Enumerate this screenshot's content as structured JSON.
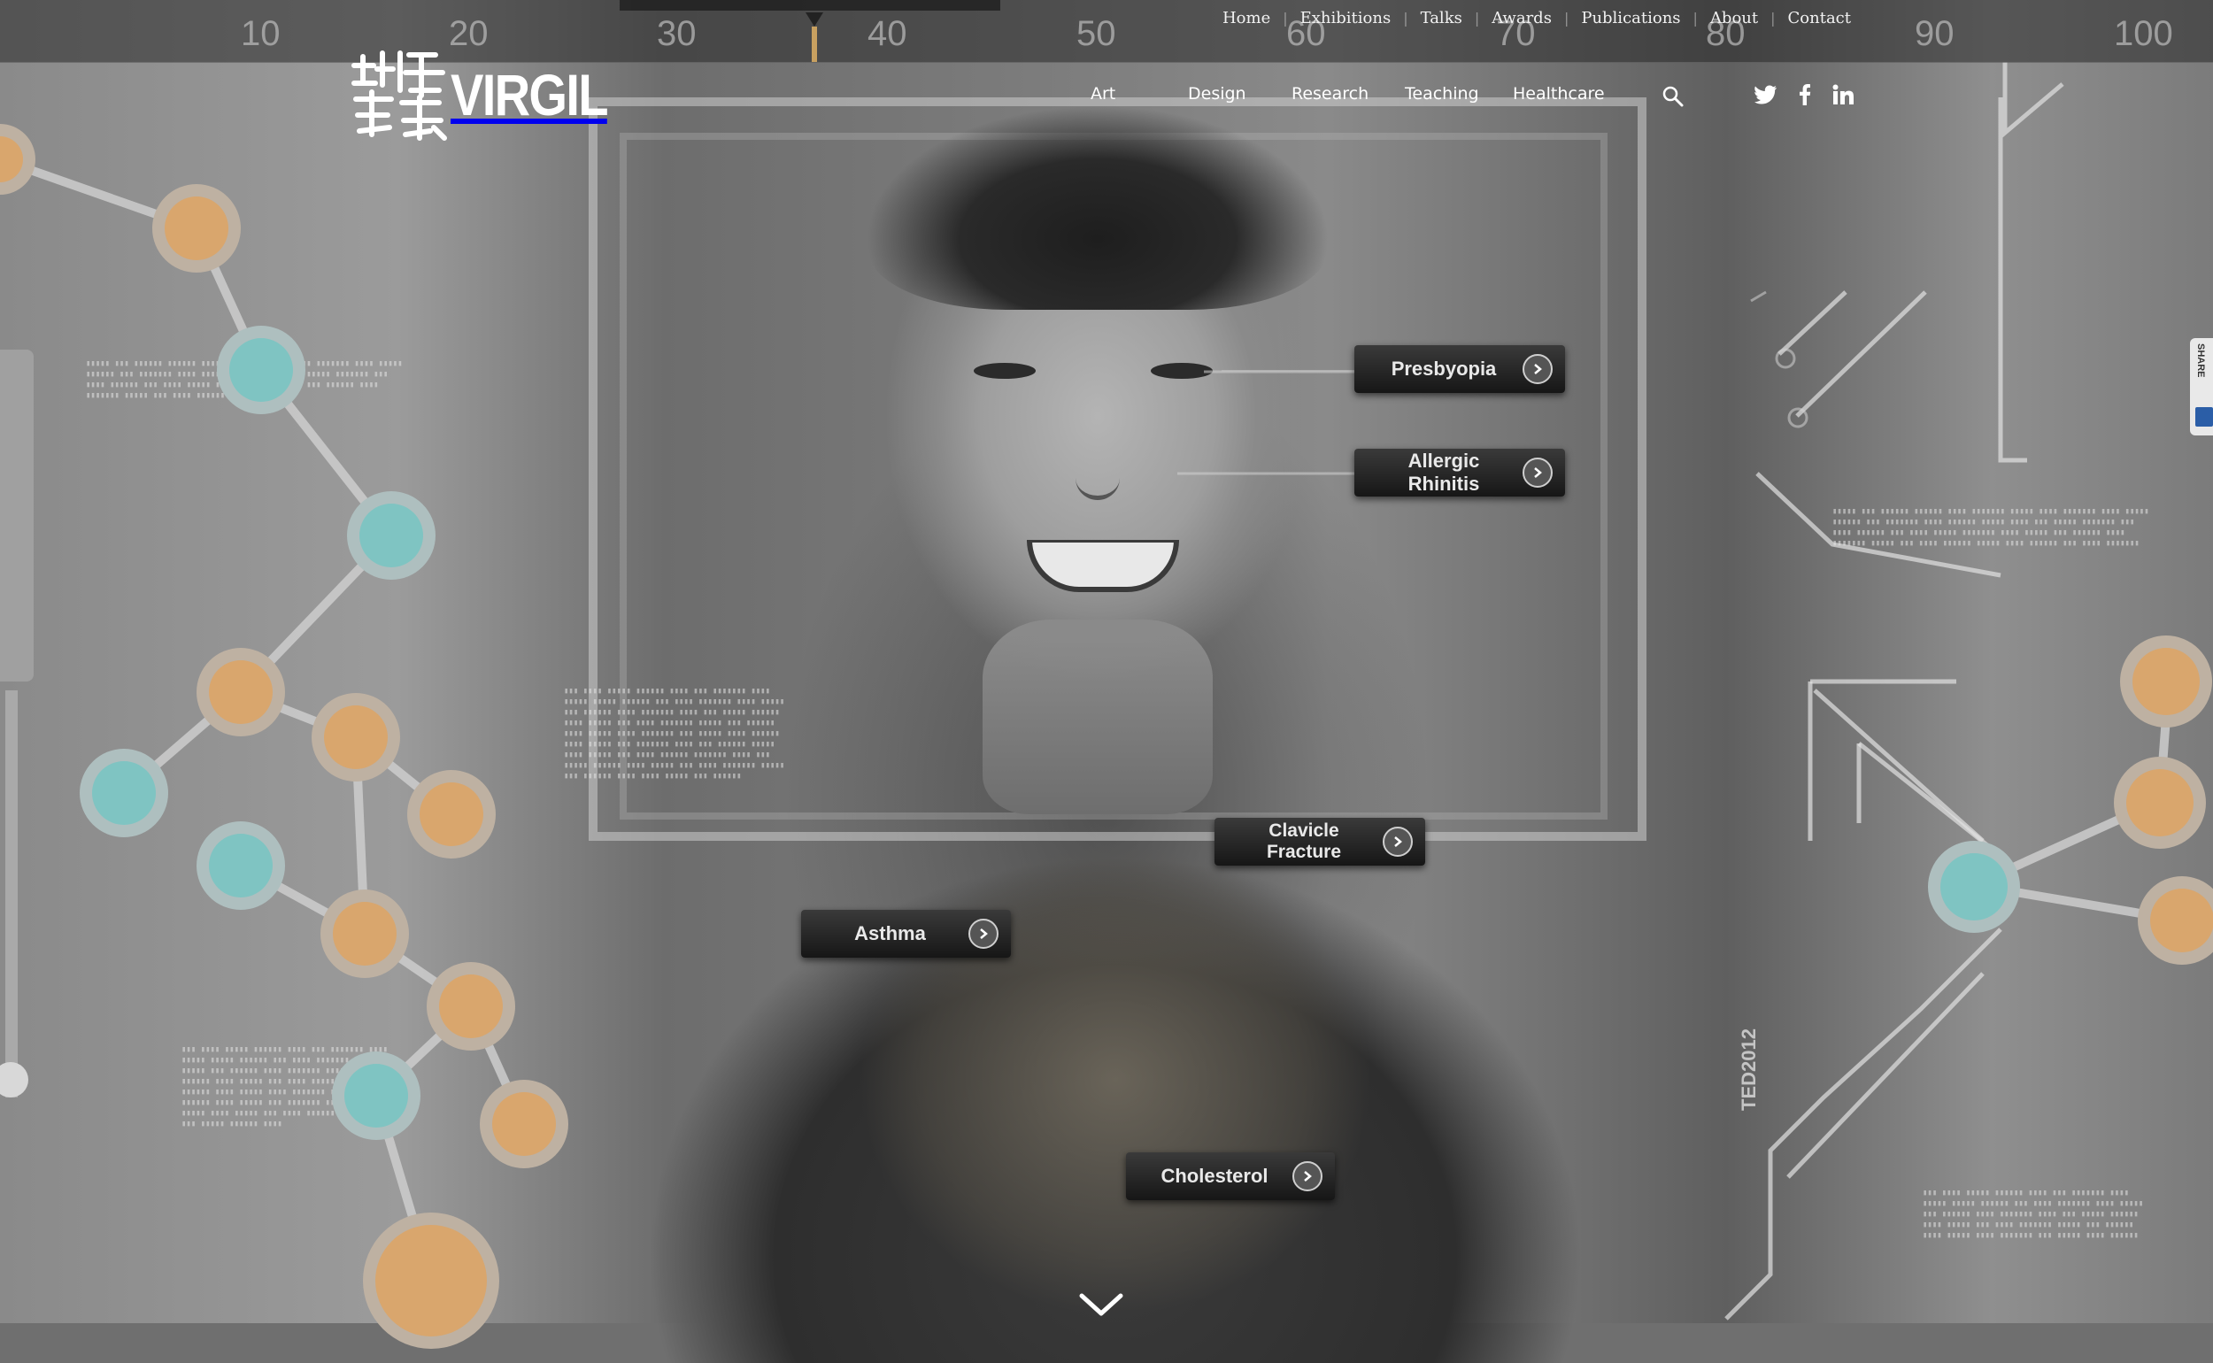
{
  "ruler": {
    "labels": [
      "10",
      "20",
      "30",
      "40",
      "50",
      "60",
      "70",
      "80",
      "90",
      "100"
    ]
  },
  "top_nav": {
    "items": [
      "Home",
      "Exhibitions",
      "Talks",
      "Awards",
      "Publications",
      "About",
      "Contact"
    ]
  },
  "logo": {
    "text": "VIRGIL"
  },
  "main_nav": {
    "items": [
      "Art",
      "Design",
      "Research",
      "Teaching",
      "Healthcare"
    ]
  },
  "social": {
    "icons": [
      "search-icon",
      "twitter-icon",
      "facebook-icon",
      "linkedin-icon"
    ]
  },
  "hotspots": {
    "presbyopia": "Presbyopia",
    "allergic_rhinitis": "Allergic Rhinitis",
    "clavicle_fracture": "Clavicle Fracture",
    "asthma": "Asthma",
    "cholesterol": "Cholesterol"
  },
  "side_label": "TED2012",
  "share": {
    "label": "SHARE"
  },
  "colors": {
    "node_orange": "#d9a66d",
    "node_teal": "#7fc4c2",
    "tag_bg": "#1f1f1f",
    "text_light": "#ffffff"
  }
}
